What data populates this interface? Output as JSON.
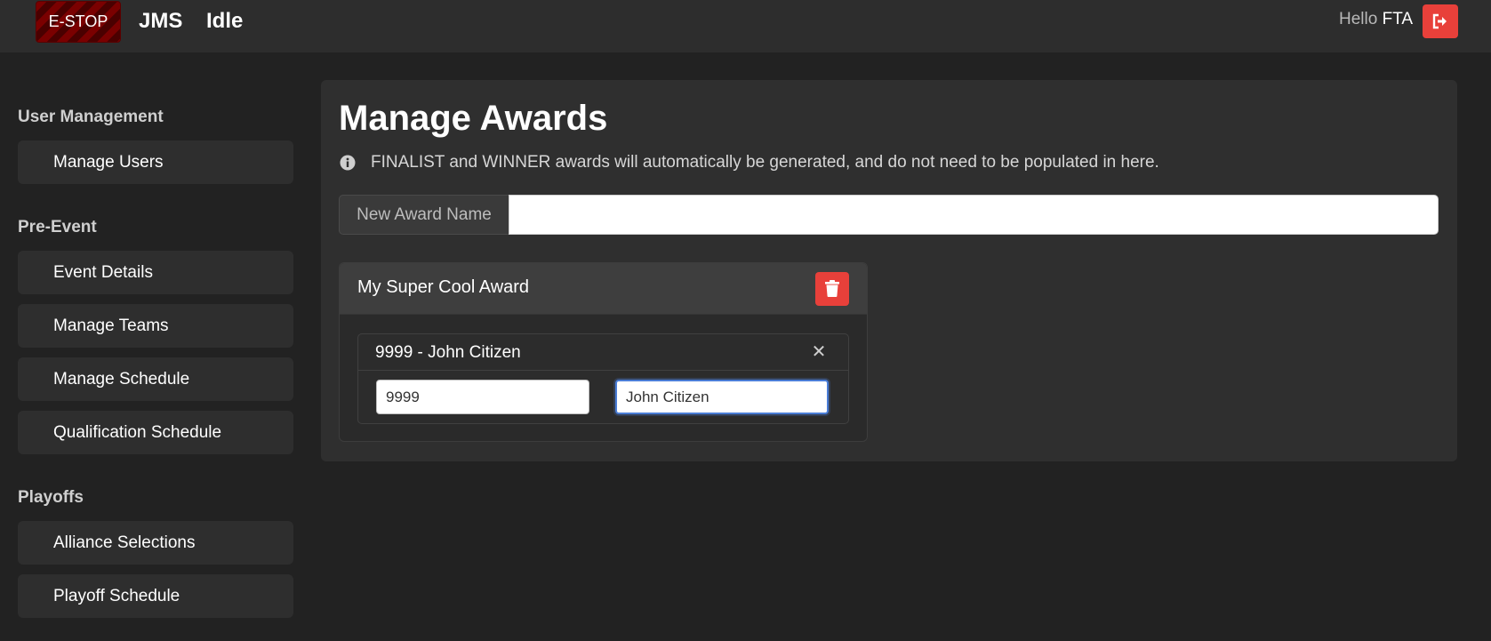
{
  "topbar": {
    "estop_label": "E-STOP",
    "brand": "JMS",
    "state": "Idle",
    "greeting": "Hello",
    "user": "FTA",
    "logout_icon": "sign-out-icon"
  },
  "sidebar": {
    "sections": [
      {
        "title": "User Management",
        "items": [
          "Manage Users"
        ]
      },
      {
        "title": "Pre-Event",
        "items": [
          "Event Details",
          "Manage Teams",
          "Manage Schedule",
          "Qualification Schedule"
        ]
      },
      {
        "title": "Playoffs",
        "items": [
          "Alliance Selections",
          "Playoff Schedule"
        ]
      }
    ]
  },
  "main": {
    "title": "Manage Awards",
    "info_text": "FINALIST and WINNER awards will automatically be generated, and do not need to be populated in here.",
    "new_award": {
      "label": "New Award Name",
      "value": ""
    },
    "awards": [
      {
        "name": "My Super Cool Award",
        "recipients": [
          {
            "title": "9999 - John Citizen",
            "team": "9999",
            "awardee": "John Citizen"
          }
        ]
      }
    ]
  },
  "colors": {
    "background": "#222222",
    "danger": "#e8403a",
    "estop": "#7a0000",
    "focus": "#4a7dd6"
  }
}
